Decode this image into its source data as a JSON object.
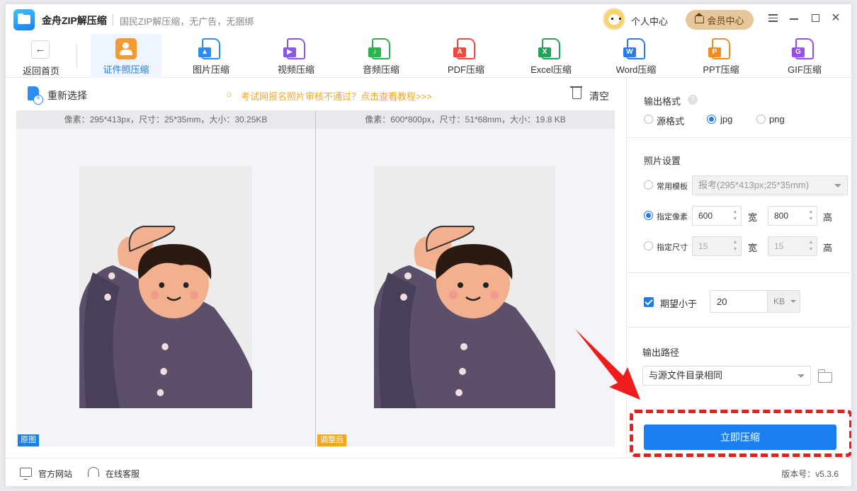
{
  "app": {
    "name": "金舟ZIP解压缩",
    "slogan": "国民ZIP解压缩，无广告，无捆绑",
    "user_center": "个人中心",
    "vip_center": "会员中心"
  },
  "toolbar": {
    "back_label": "返回首页",
    "tabs": [
      {
        "label": "证件照压缩",
        "icon": "id-photo-icon",
        "active": true
      },
      {
        "label": "图片压缩",
        "icon": "image-file-icon",
        "active": false,
        "color": "#2b8cf3"
      },
      {
        "label": "视频压缩",
        "icon": "video-file-icon",
        "active": false,
        "color": "#8a57e8"
      },
      {
        "label": "音频压缩",
        "icon": "audio-file-icon",
        "active": false,
        "color": "#2bb34f"
      },
      {
        "label": "PDF压缩",
        "icon": "pdf-file-icon",
        "active": false,
        "color": "#ee4a3c"
      },
      {
        "label": "Excel压缩",
        "icon": "excel-file-icon",
        "active": false,
        "color": "#23a35a"
      },
      {
        "label": "Word压缩",
        "icon": "word-file-icon",
        "active": false,
        "color": "#2b7be8"
      },
      {
        "label": "PPT压缩",
        "icon": "ppt-file-icon",
        "active": false,
        "color": "#f28b20"
      },
      {
        "label": "GIF压缩",
        "icon": "gif-file-icon",
        "active": false,
        "color": "#9a4ee8"
      }
    ]
  },
  "actions": {
    "reselect": "重新选择",
    "tip": "考试网报名照片审核不通过？点击查看教程>>>",
    "clear": "清空"
  },
  "preview": {
    "original_info": "像素：295*413px，尺寸：25*35mm，大小：30.25KB",
    "adjusted_info": "像素：600*800px，尺寸：51*68mm，大小：19.8 KB",
    "original_tag": "原图",
    "adjusted_tag": "调整后"
  },
  "settings": {
    "output_format_title": "输出格式",
    "help": "?",
    "formats": [
      "源格式",
      "jpg",
      "png"
    ],
    "selected_format": "jpg",
    "photo_settings_title": "照片设置",
    "template_label": "常用模板",
    "template_value": "报考(295*413px;25*35mm)",
    "pixel_label": "指定像素",
    "pixel_width": "600",
    "pixel_height": "800",
    "size_label": "指定尺寸",
    "size_width": "15",
    "size_height": "15",
    "width_unit": "宽",
    "height_unit": "高",
    "spin_up": "▲",
    "spin_down": "▼",
    "expect_label": "期望小于",
    "expect_value": "20",
    "expect_unit": "KB",
    "output_path_title": "输出路径",
    "output_path_value": "与源文件目录相同",
    "compress_button": "立即压缩"
  },
  "statusbar": {
    "website": "官方网站",
    "support": "在线客服",
    "version": "版本号：v5.3.6"
  },
  "colors": {
    "accent": "#1a7fef",
    "tip": "#f5a623",
    "highlight": "#ee1c1c"
  }
}
